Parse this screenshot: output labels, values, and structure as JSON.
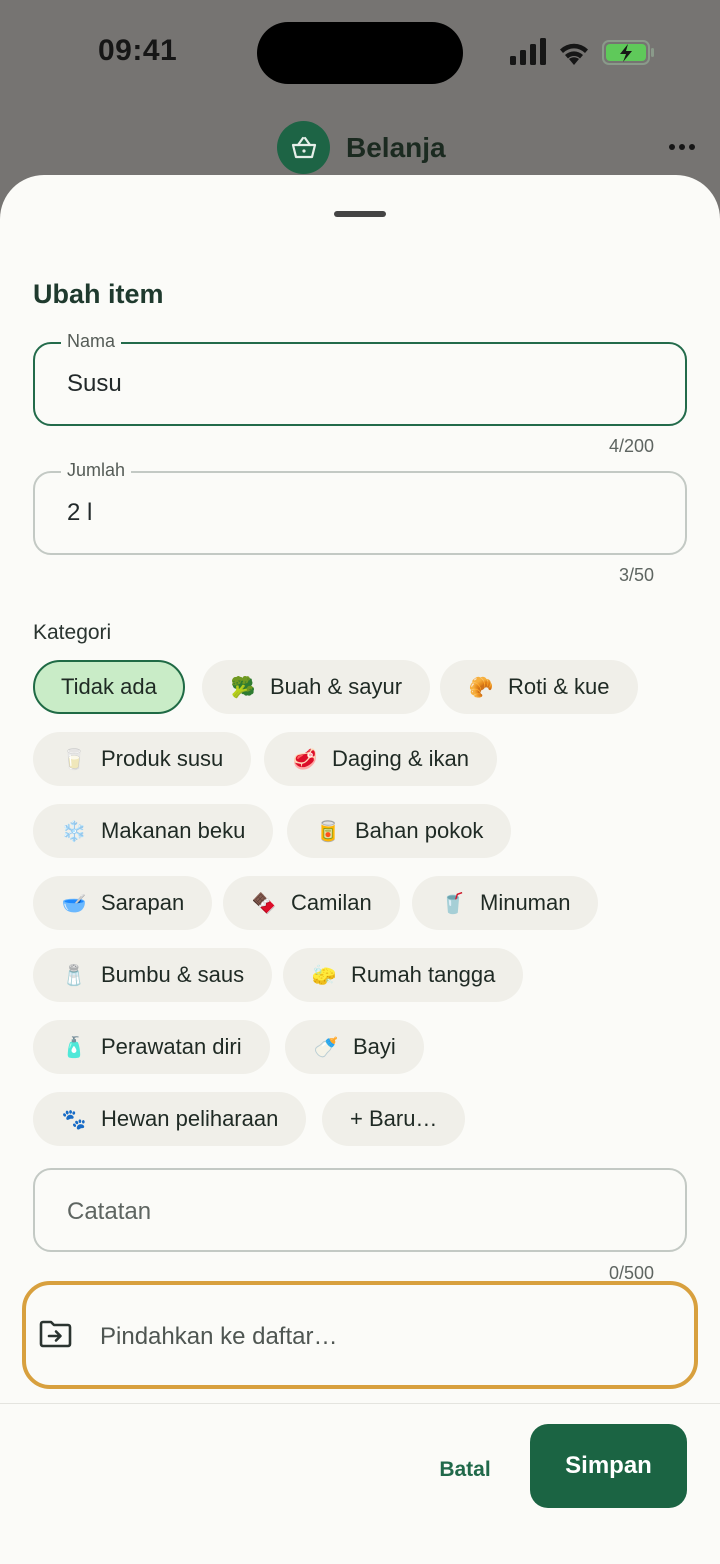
{
  "status_bar": {
    "time": "09:41"
  },
  "app_header": {
    "title": "Belanja"
  },
  "sheet": {
    "title": "Ubah item",
    "name_field": {
      "label": "Nama",
      "value": "Susu",
      "counter": "4/200"
    },
    "quantity_field": {
      "label": "Jumlah",
      "value": "2 l",
      "counter": "3/50"
    },
    "category_label": "Kategori",
    "categories": [
      {
        "label": "Tidak ada",
        "emoji": "",
        "selected": true
      },
      {
        "label": "Buah & sayur",
        "emoji": "🥦"
      },
      {
        "label": "Roti & kue",
        "emoji": "🥐"
      },
      {
        "label": "Produk susu",
        "emoji": "🥛"
      },
      {
        "label": "Daging & ikan",
        "emoji": "🥩"
      },
      {
        "label": "Makanan beku",
        "emoji": "❄️"
      },
      {
        "label": "Bahan pokok",
        "emoji": "🥫"
      },
      {
        "label": "Sarapan",
        "emoji": "🥣"
      },
      {
        "label": "Camilan",
        "emoji": "🍫"
      },
      {
        "label": "Minuman",
        "emoji": "🥤"
      },
      {
        "label": "Bumbu & saus",
        "emoji": "🧂"
      },
      {
        "label": "Rumah tangga",
        "emoji": "🧽"
      },
      {
        "label": "Perawatan diri",
        "emoji": "🧴"
      },
      {
        "label": "Bayi",
        "emoji": "🍼"
      },
      {
        "label": "Hewan peliharaan",
        "emoji": "🐾"
      },
      {
        "label": "+ Baru…",
        "emoji": ""
      }
    ],
    "notes_field": {
      "placeholder": "Catatan",
      "counter": "0/500"
    },
    "move_field": {
      "placeholder": "Pindahkan ke daftar…",
      "icon": "move-to-folder-icon"
    },
    "cancel_label": "Batal",
    "save_label": "Simpan"
  },
  "colors": {
    "accent": "#1b6443",
    "selected_chip": "#c9ecc7",
    "highlight": "#d8a03e"
  }
}
